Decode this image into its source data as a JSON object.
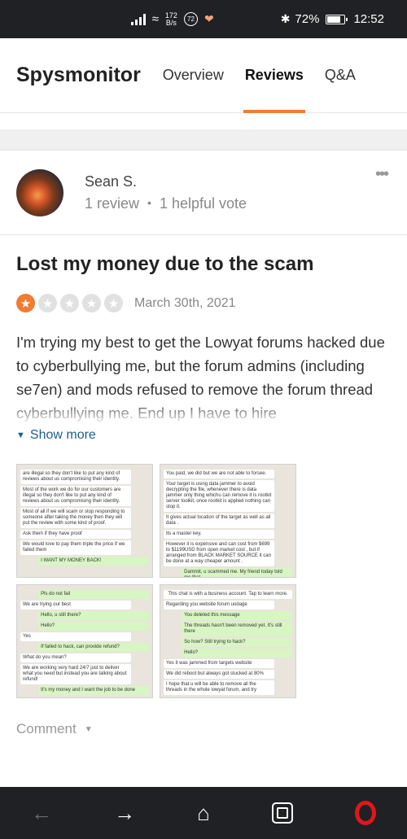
{
  "status_bar": {
    "speed_value": "172",
    "speed_unit": "B/s",
    "circle_badge": "72",
    "battery": "72%",
    "time": "12:52"
  },
  "nav": {
    "brand": "Spysmonitor",
    "tabs": [
      {
        "label": "Overview",
        "active": false
      },
      {
        "label": "Reviews",
        "active": true
      },
      {
        "label": "Q&A",
        "active": false
      }
    ]
  },
  "reviewer": {
    "name": "Sean S.",
    "reviews": "1 review",
    "votes": "1 helpful vote"
  },
  "review": {
    "title": "Lost my money due to the scam",
    "stars": 1,
    "max_stars": 5,
    "date": "March 30th, 2021",
    "body": "I'm trying my best to get the Lowyat forums hacked due to cyberbullying me, but the forum admins (including se7en) and mods refused to remove the forum thread cyberbullying me. End up I have to hire",
    "show_more": "Show more"
  },
  "photos": [
    {
      "messages": [
        {
          "t": "are illegal so they don't like to put any kind of reviews about us compromising their identity.",
          "s": "in"
        },
        {
          "t": "Most of the work we do for our customers are illegal so they don't like to put any kind of reviews about us compromising their identity.",
          "s": "in"
        },
        {
          "t": "Most of all if we will scam or stop responding to someone after taking the money then they will put the review with some kind of proof.",
          "s": "in"
        },
        {
          "t": "Ask them if they have proof",
          "s": "in"
        },
        {
          "t": "We would love to pay them triple the price if we failed them",
          "s": "in"
        },
        {
          "t": "I WANT MY MONEY BACK!",
          "s": "out"
        }
      ]
    },
    {
      "messages": [
        {
          "t": "You paid, we did but we are not able to forsee.",
          "s": "in"
        },
        {
          "t": "Your target is using data jammer to avoid decrypting the file, whenever there is data jammer only thing whichu can remove it is rootkit server toolkit, once rootkit is applied nothing can stop it.",
          "s": "in"
        },
        {
          "t": "It gives actual location of the target as well as all data .",
          "s": "in"
        },
        {
          "t": "Its a master key.",
          "s": "in"
        },
        {
          "t": "However it is expensive and can cost from $699 to $1199USD from open market cost , but if arranged from BLACK MARKET SOURCE it can be done at a way cheaper amount .",
          "s": "in"
        },
        {
          "t": "Dammit, u scammed me. My friend today told me that",
          "s": "out"
        }
      ]
    },
    {
      "messages": [
        {
          "t": "Pls do not fail",
          "s": "out"
        },
        {
          "t": "We are trying our best",
          "s": "in"
        },
        {
          "t": "Hello, u still there?",
          "s": "out"
        },
        {
          "t": "Hello?",
          "s": "out"
        },
        {
          "t": "Yes",
          "s": "in"
        },
        {
          "t": "If failed to hack, can provide refund?",
          "s": "out"
        },
        {
          "t": "What do you mean?",
          "s": "in"
        },
        {
          "t": "We are working very hard 24/7 just to deliver what you need but instead you are talking about refund!",
          "s": "in"
        },
        {
          "t": "It's my money and I want the job to be done",
          "s": "out"
        }
      ]
    },
    {
      "messages": [
        {
          "t": "This chat is with a business account. Tap to learn more.",
          "s": "sys"
        },
        {
          "t": "Regarding you website forum uodage",
          "s": "in"
        },
        {
          "t": "You deleted this message",
          "s": "out"
        },
        {
          "t": "The threads hasn't been removed yet. It's still there",
          "s": "out"
        },
        {
          "t": "So how? Still trying to hack?",
          "s": "out"
        },
        {
          "t": "Hello?",
          "s": "out"
        },
        {
          "t": "Yes it was jammed from targets website",
          "s": "in"
        },
        {
          "t": "We did reboot but always got stucked at 80%",
          "s": "in"
        },
        {
          "t": "I hope that u will be able to remove all the threads in the whole lowyat forum, and try",
          "s": "in"
        }
      ]
    }
  ],
  "comment": {
    "label": "Comment"
  },
  "colors": {
    "accent": "#f07b32",
    "link": "#1a5f8a",
    "opera_red": "#e0161c"
  }
}
